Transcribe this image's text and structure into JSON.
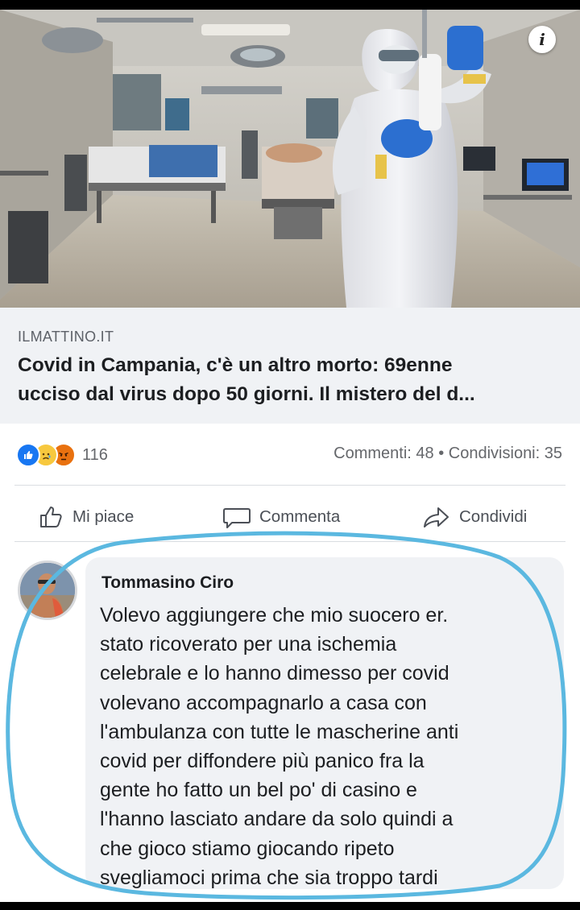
{
  "post": {
    "info_icon": "info-icon",
    "link": {
      "source": "ILMATTINO.IT",
      "headline_line1": "Covid in Campania, c'è un altro morto: 69enne",
      "headline_line2": "ucciso dal virus dopo 50 giorni. Il mistero del d..."
    },
    "reactions": {
      "icons": [
        "like-icon",
        "sad-icon",
        "angry-icon"
      ],
      "count": "116",
      "comments": "Commenti: 48",
      "separator": "•",
      "shares": "Condivisioni: 35"
    },
    "actions": {
      "like": "Mi piace",
      "comment": "Commenta",
      "share": "Condividi"
    }
  },
  "comment": {
    "author": "Tommasino Ciro",
    "lines": [
      "Volevo aggiungere che mio suocero er.",
      "stato ricoverato per una ischemia",
      "celebrale e lo hanno dimesso per covid",
      "volevano accompagnarlo a casa con",
      "l'ambulanza con tutte le mascherine anti",
      "covid per diffondere più panico fra la",
      "gente ho fatto un bel po' di casino e",
      "l'hanno lasciato andare da solo quindi a",
      "che gioco stiamo giocando ripeto",
      "svegliamoci prima che sia troppo tardi"
    ]
  },
  "colors": {
    "link_bg": "#f0f2f5",
    "like_blue": "#1877f2",
    "annotation_circle": "#5bb8e0"
  }
}
